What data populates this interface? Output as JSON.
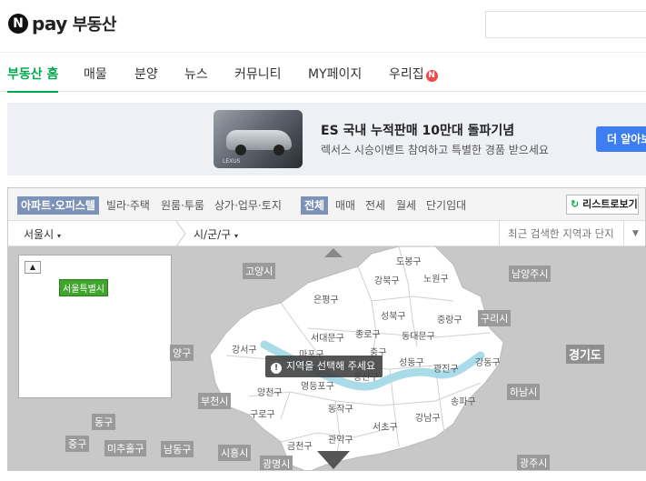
{
  "header": {
    "logo_n": "N",
    "logo_pay": "pay",
    "title": "부동산"
  },
  "nav": {
    "items": [
      {
        "label": "부동산 홈",
        "active": true
      },
      {
        "label": "매물"
      },
      {
        "label": "분양"
      },
      {
        "label": "뉴스"
      },
      {
        "label": "커뮤니티"
      },
      {
        "label": "MY페이지"
      },
      {
        "label": "우리집",
        "badge": "N"
      }
    ]
  },
  "banner": {
    "title": "ES 국내 누적판매 10만대 돌파기념",
    "subtitle": "렉서스 시승이벤트 참여하고 특별한 경품 받으세요",
    "button": "더 알아보",
    "image_brand": "LEXUS"
  },
  "filters": {
    "property_types": [
      "아파트·오피스텔",
      "빌라·주택",
      "원룸·투룸",
      "상가·업무·토지"
    ],
    "trade_types": [
      "전체",
      "매매",
      "전세",
      "월세",
      "단기임대"
    ],
    "list_button": "리스트로보기"
  },
  "region": {
    "city": "서울시",
    "district": "시/군/구",
    "recent_placeholder": "최근 검색한 지역과 단지"
  },
  "map": {
    "mini_label": "서울특별시",
    "tooltip": "지역을 선택해 주세요",
    "districts": [
      "도봉구",
      "강북구",
      "노원구",
      "은평구",
      "성북구",
      "중랑구",
      "서대문구",
      "종로구",
      "동대문구",
      "강서구",
      "마포구",
      "중구",
      "성동구",
      "광진구",
      "강동구",
      "용산구",
      "양천구",
      "영등포구",
      "동작구",
      "송파구",
      "구로구",
      "서초구",
      "강남구",
      "금천구",
      "관악구"
    ],
    "outer_labels": [
      "고양시",
      "남양주시",
      "구리시",
      "경기도",
      "양구",
      "부천시",
      "하남시",
      "동구",
      "중구",
      "미추홀구",
      "남동구",
      "시흥시",
      "광명시",
      "광주시"
    ]
  },
  "colors": {
    "accent": "#03a94f",
    "river": "#a9dbe8",
    "badge": "#f04848"
  }
}
